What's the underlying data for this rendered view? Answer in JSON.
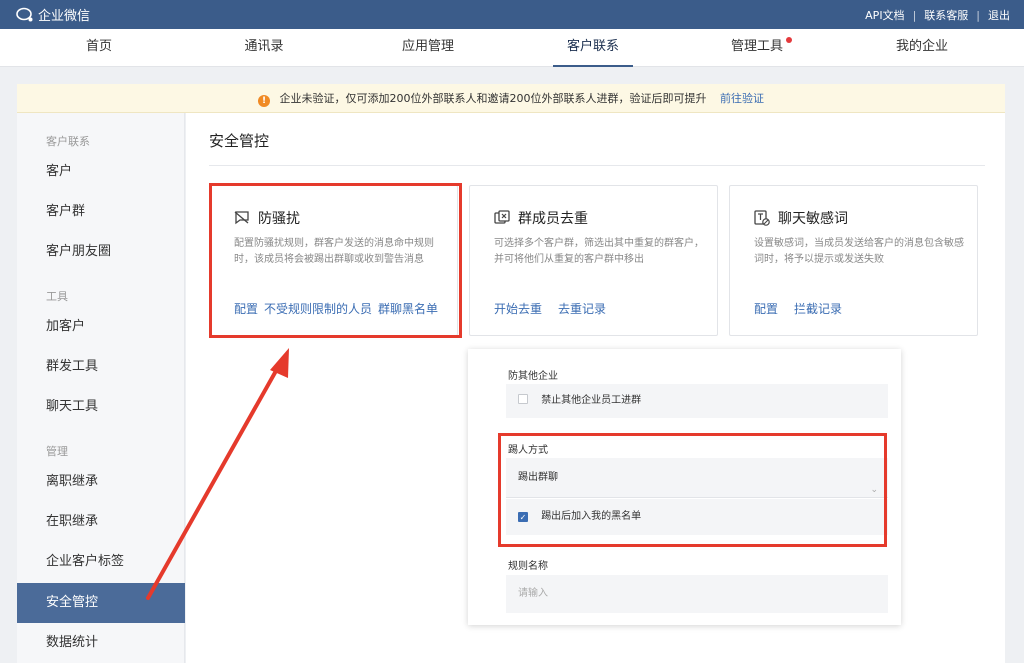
{
  "app": {
    "title": "企业微信"
  },
  "top_links": [
    "API文档",
    "联系客服",
    "退出"
  ],
  "nav": [
    {
      "label": "首页",
      "active": false,
      "dot": false
    },
    {
      "label": "通讯录",
      "active": false,
      "dot": false
    },
    {
      "label": "应用管理",
      "active": false,
      "dot": false
    },
    {
      "label": "客户联系",
      "active": true,
      "dot": false
    },
    {
      "label": "管理工具",
      "active": false,
      "dot": true
    },
    {
      "label": "我的企业",
      "active": false,
      "dot": false
    }
  ],
  "banner": {
    "text": "企业未验证，仅可添加200位外部联系人和邀请200位外部联系人进群，验证后即可提升",
    "link": "前往验证"
  },
  "sidebar": {
    "groups": [
      "客户联系",
      "工具",
      "管理"
    ],
    "items": [
      "客户",
      "客户群",
      "客户朋友圈",
      "加客户",
      "群发工具",
      "聊天工具",
      "离职继承",
      "在职继承",
      "企业客户标签",
      "安全管控",
      "数据统计"
    ]
  },
  "main": {
    "title": "安全管控",
    "cards": [
      {
        "title": "防骚扰",
        "icon": "harassment-icon",
        "desc": "配置防骚扰规则，群客户发送的消息命中规则时，该成员将会被踢出群聊或收到警告消息",
        "links": [
          "配置",
          "不受规则限制的人员",
          "群聊黑名单"
        ]
      },
      {
        "title": "群成员去重",
        "icon": "dedupe-icon",
        "desc": "可选择多个客户群，筛选出其中重复的群客户，并可将他们从重复的客户群中移出",
        "links": [
          "开始去重",
          "去重记录"
        ]
      },
      {
        "title": "聊天敏感词",
        "icon": "sensitive-word-icon",
        "desc": "设置敏感词，当成员发送给客户的消息包含敏感词时，将予以提示或发送失败",
        "links": [
          "配置",
          "拦截记录"
        ]
      }
    ]
  },
  "panel": {
    "section1": {
      "label": "防其他企业",
      "checkbox_label": "禁止其他企业员工进群",
      "checked": false
    },
    "section2": {
      "label": "踢人方式",
      "select_value": "踢出群聊",
      "checkbox_label": "踢出后加入我的黑名单",
      "checked": true
    },
    "section3": {
      "label": "规则名称",
      "placeholder": "请输入"
    }
  },
  "colors": {
    "topbar": "#3b5c8a",
    "highlight": "#e53a2c",
    "link": "#3b6db3",
    "active_side": "#4b6b99"
  }
}
